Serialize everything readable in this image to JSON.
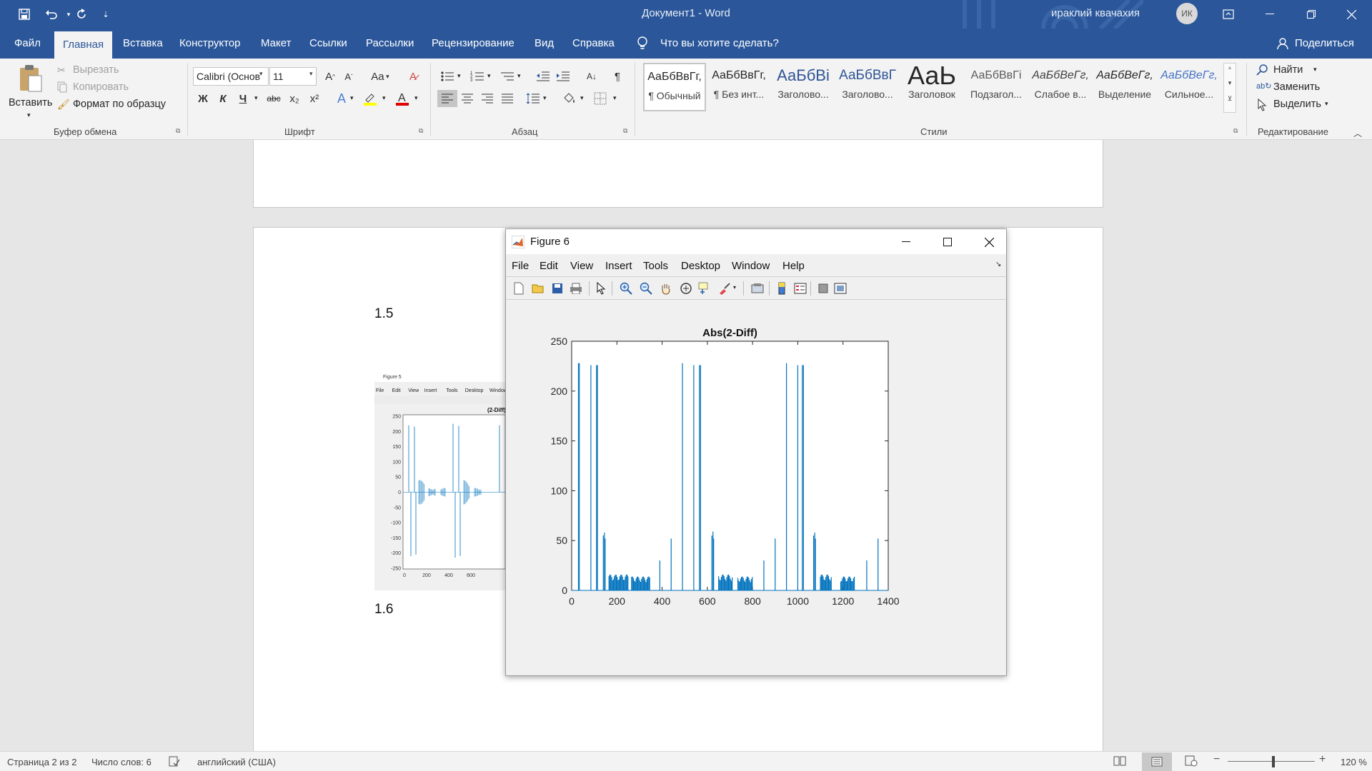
{
  "window": {
    "title": "Документ1  -  Word",
    "user": "ираклий квачахия",
    "avatar": "ИК"
  },
  "quick_access": [
    "save-icon",
    "undo-icon",
    "redo-icon",
    "customize-icon"
  ],
  "tabs": [
    "Файл",
    "Главная",
    "Вставка",
    "Конструктор",
    "Макет",
    "Ссылки",
    "Рассылки",
    "Рецензирование",
    "Вид",
    "Справка"
  ],
  "active_tab": "Главная",
  "tell_me": "Что вы хотите сделать?",
  "share": "Поделиться",
  "clipboard": {
    "paste": "Вставить",
    "cut": "Вырезать",
    "copy": "Копировать",
    "format_painter": "Формат по образцу",
    "label": "Буфер обмена"
  },
  "font": {
    "name": "Calibri (Основ",
    "size": "11",
    "label": "Шрифт",
    "bold": "Ж",
    "italic": "К",
    "underline": "Ч",
    "strike": "abc",
    "sub": "x₂",
    "sup": "x²",
    "grow": "A",
    "shrink": "A",
    "case": "Aa"
  },
  "paragraph": {
    "label": "Абзац"
  },
  "styles": {
    "label": "Стили",
    "items": [
      {
        "preview": "АаБбВвГг,",
        "name": "¶ Обычный"
      },
      {
        "preview": "АаБбВвГг,",
        "name": "¶ Без инт..."
      },
      {
        "preview": "АаБбВі",
        "name": "Заголово..."
      },
      {
        "preview": "АаБбВвГ",
        "name": "Заголово..."
      },
      {
        "preview": "АаЬ",
        "name": "Заголовок"
      },
      {
        "preview": "АаБбВвГі",
        "name": "Подзагол..."
      },
      {
        "preview": "АаБбВеГг,",
        "name": "Слабое в..."
      },
      {
        "preview": "АаБбВеГг,",
        "name": "Выделение"
      },
      {
        "preview": "АаБбВеГг,",
        "name": "Сильное..."
      }
    ]
  },
  "editing": {
    "find": "Найти",
    "replace": "Заменить",
    "select": "Выделить",
    "label": "Редактирование"
  },
  "document": {
    "heading_1": "1.5",
    "heading_2": "1.6"
  },
  "thumbnail": {
    "title": "Figure 5",
    "menus": [
      "File",
      "Edit",
      "View",
      "Insert",
      "Tools",
      "Desktop",
      "Window"
    ],
    "plot_title": "(2-Diff)",
    "yticks": [
      "250",
      "200",
      "150",
      "100",
      "50",
      "0",
      "-50",
      "-100",
      "-150",
      "-200",
      "-250"
    ],
    "xticks": [
      "0",
      "200",
      "400",
      "600"
    ]
  },
  "figure": {
    "title": "Figure 6",
    "menus": [
      "File",
      "Edit",
      "View",
      "Insert",
      "Tools",
      "Desktop",
      "Window",
      "Help"
    ]
  },
  "chart_data": {
    "type": "line",
    "title": "Abs(2-Diff)",
    "xlabel": "",
    "ylabel": "",
    "xlim": [
      0,
      1400
    ],
    "ylim": [
      0,
      250
    ],
    "xticks": [
      0,
      200,
      400,
      600,
      800,
      1000,
      1200,
      1400
    ],
    "yticks": [
      0,
      50,
      100,
      150,
      200,
      250
    ],
    "grid": false,
    "color": "#0072bd",
    "spikes": [
      [
        30,
        228
      ],
      [
        34,
        228
      ],
      [
        85,
        226
      ],
      [
        110,
        226
      ],
      [
        114,
        226
      ],
      [
        490,
        228
      ],
      [
        540,
        226
      ],
      [
        565,
        226
      ],
      [
        570,
        226
      ],
      [
        950,
        228
      ],
      [
        1000,
        226
      ],
      [
        1020,
        226
      ],
      [
        1025,
        226
      ],
      [
        140,
        55
      ],
      [
        145,
        58
      ],
      [
        148,
        52
      ],
      [
        620,
        55
      ],
      [
        625,
        59
      ],
      [
        628,
        52
      ],
      [
        1070,
        55
      ],
      [
        1075,
        58
      ],
      [
        1078,
        52
      ],
      [
        390,
        30
      ],
      [
        440,
        52
      ],
      [
        850,
        30
      ],
      [
        900,
        52
      ],
      [
        1305,
        30
      ],
      [
        1355,
        52
      ]
    ],
    "noise_bands": [
      [
        165,
        250,
        16
      ],
      [
        265,
        345,
        14
      ],
      [
        650,
        710,
        16
      ],
      [
        735,
        800,
        14
      ],
      [
        1100,
        1150,
        16
      ],
      [
        1190,
        1250,
        14
      ]
    ]
  },
  "status": {
    "page": "Страница 2 из 2",
    "words": "Число слов: 6",
    "language": "английский (США)",
    "zoom": "120 %"
  }
}
